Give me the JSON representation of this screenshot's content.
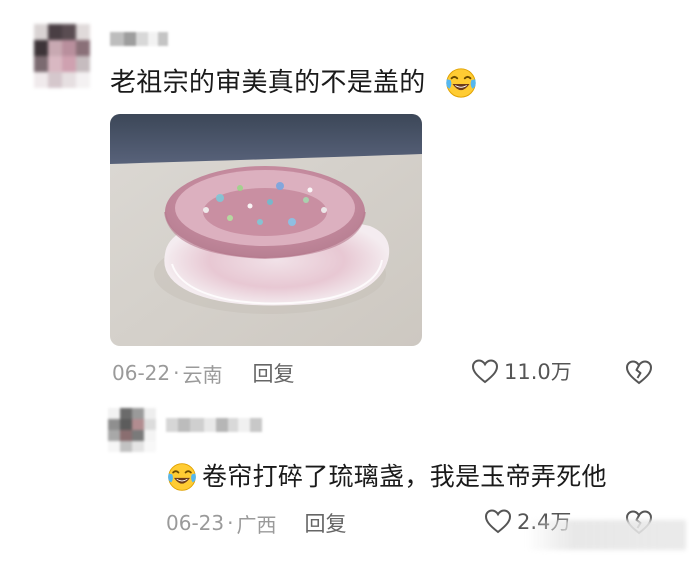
{
  "main_comment": {
    "text": "老祖宗的审美真的不是盖的",
    "emoji": "face-with-tears-of-joy",
    "date": "06-22",
    "location": "云南",
    "reply_label": "回复",
    "likes": "11.0万"
  },
  "reply_comment": {
    "emoji": "face-with-tears-of-joy",
    "text": "卷帘打碎了琉璃盏，我是玉帝弄死他",
    "date": "06-23",
    "location": "广西",
    "reply_label": "回复",
    "likes": "2.4万"
  },
  "colors": {
    "text": "#1a1a1a",
    "meta": "#9a9a9a",
    "icon_stroke": "#555555"
  }
}
